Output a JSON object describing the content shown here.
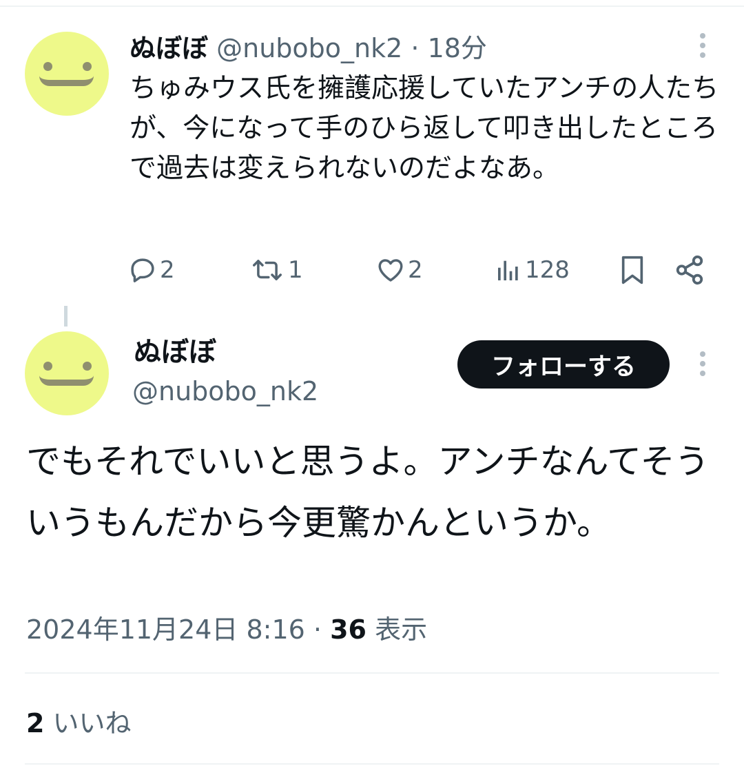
{
  "tweet1": {
    "display_name": "ぬぼぼ",
    "handle": "@nubobo_nk2",
    "separator": "·",
    "time": "18分",
    "text": "ちゅみウス氏を擁護応援していたアンチの人たちが、今になって手のひら返して叩き出したところで過去は変えられないのだよなあ。",
    "actions": {
      "replies": "2",
      "retweets": "1",
      "likes": "2",
      "views": "128"
    }
  },
  "tweet2": {
    "display_name": "ぬぼぼ",
    "handle": "@nubobo_nk2",
    "follow_label": "フォローする",
    "text": "でもそれでいいと思うよ。アンチなんてそういうもんだから今更驚かんというか。",
    "date": "2024年11月24日 8:16",
    "separator": "·",
    "views_count": "36",
    "views_label": "表示",
    "likes_count": "2",
    "likes_label": "いいね"
  },
  "colors": {
    "avatar_bg": "#eef98a",
    "text_primary": "#0f1419",
    "text_secondary": "#536471",
    "button_bg": "#0f1419"
  },
  "icons": [
    "reply-icon",
    "retweet-icon",
    "like-icon",
    "views-icon",
    "bookmark-icon",
    "share-icon",
    "more-icon"
  ]
}
